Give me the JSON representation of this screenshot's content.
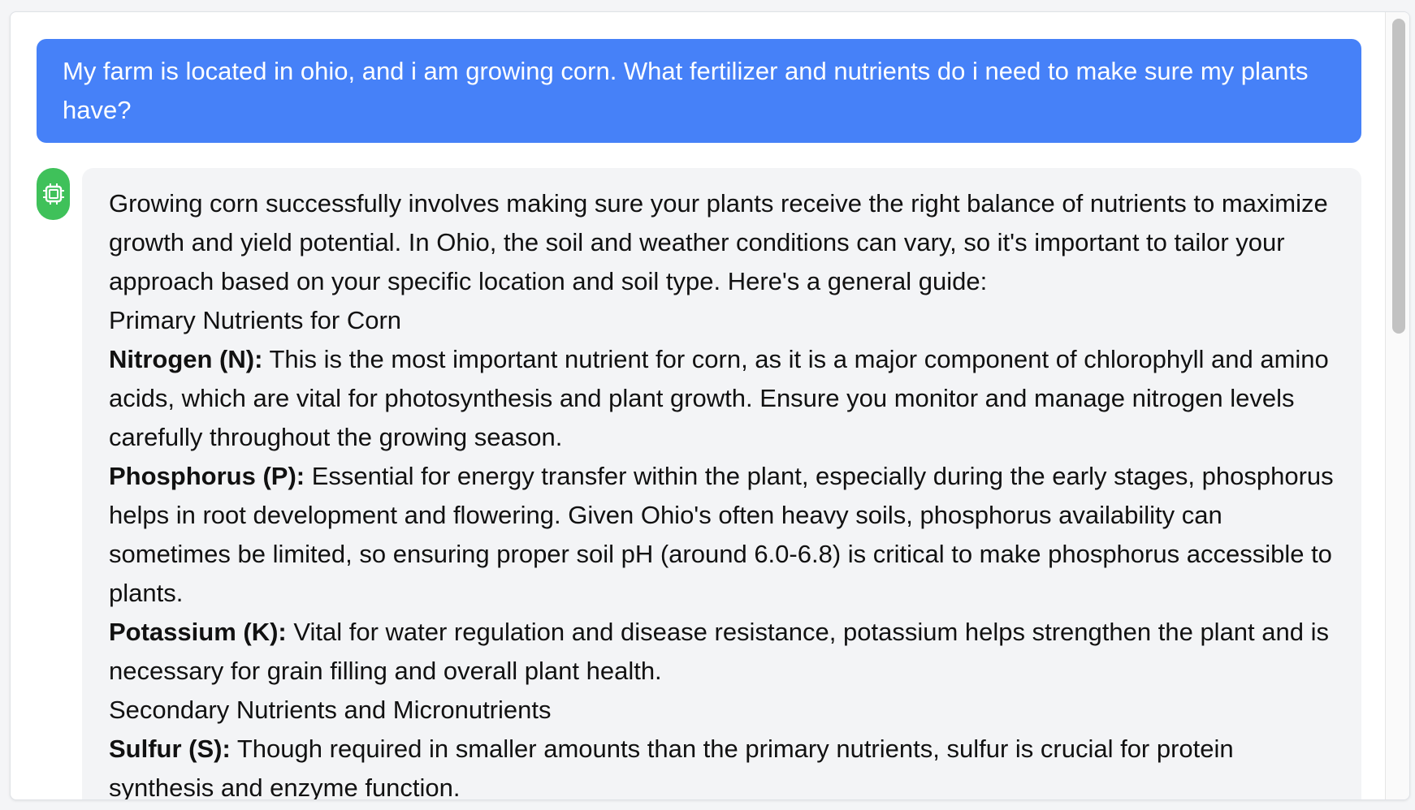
{
  "conversation": {
    "user_message": "My farm is located in ohio, and i am growing corn. What fertilizer and nutrients do i need to make sure my plants have?",
    "assistant": {
      "avatar_icon": "chip-icon",
      "intro": "Growing corn successfully involves making sure your plants receive the right balance of nutrients to maximize growth and yield potential. In Ohio, the soil and weather conditions can vary, so it's important to tailor your approach based on your specific location and soil type. Here's a general guide:",
      "section_primary": "Primary Nutrients for Corn",
      "nitrogen_label": "Nitrogen (N):",
      "nitrogen_text": " This is the most important nutrient for corn, as it is a major component of chlorophyll and amino acids, which are vital for photosynthesis and plant growth. Ensure you monitor and manage nitrogen levels carefully throughout the growing season.",
      "phosphorus_label": "Phosphorus (P):",
      "phosphorus_text": " Essential for energy transfer within the plant, especially during the early stages, phosphorus helps in root development and flowering. Given Ohio's often heavy soils, phosphorus availability can sometimes be limited, so ensuring proper soil pH (around 6.0-6.8) is critical to make phosphorus accessible to plants.",
      "potassium_label": "Potassium (K):",
      "potassium_text": " Vital for water regulation and disease resistance, potassium helps strengthen the plant and is necessary for grain filling and overall plant health.",
      "section_secondary": "Secondary Nutrients and Micronutrients",
      "sulfur_label": "Sulfur (S):",
      "sulfur_text": " Though required in smaller amounts than the primary nutrients, sulfur is crucial for protein synthesis and enzyme function."
    }
  },
  "colors": {
    "user_bubble": "#4681f8",
    "assistant_bubble": "#f3f4f6",
    "avatar": "#3fc15a"
  }
}
